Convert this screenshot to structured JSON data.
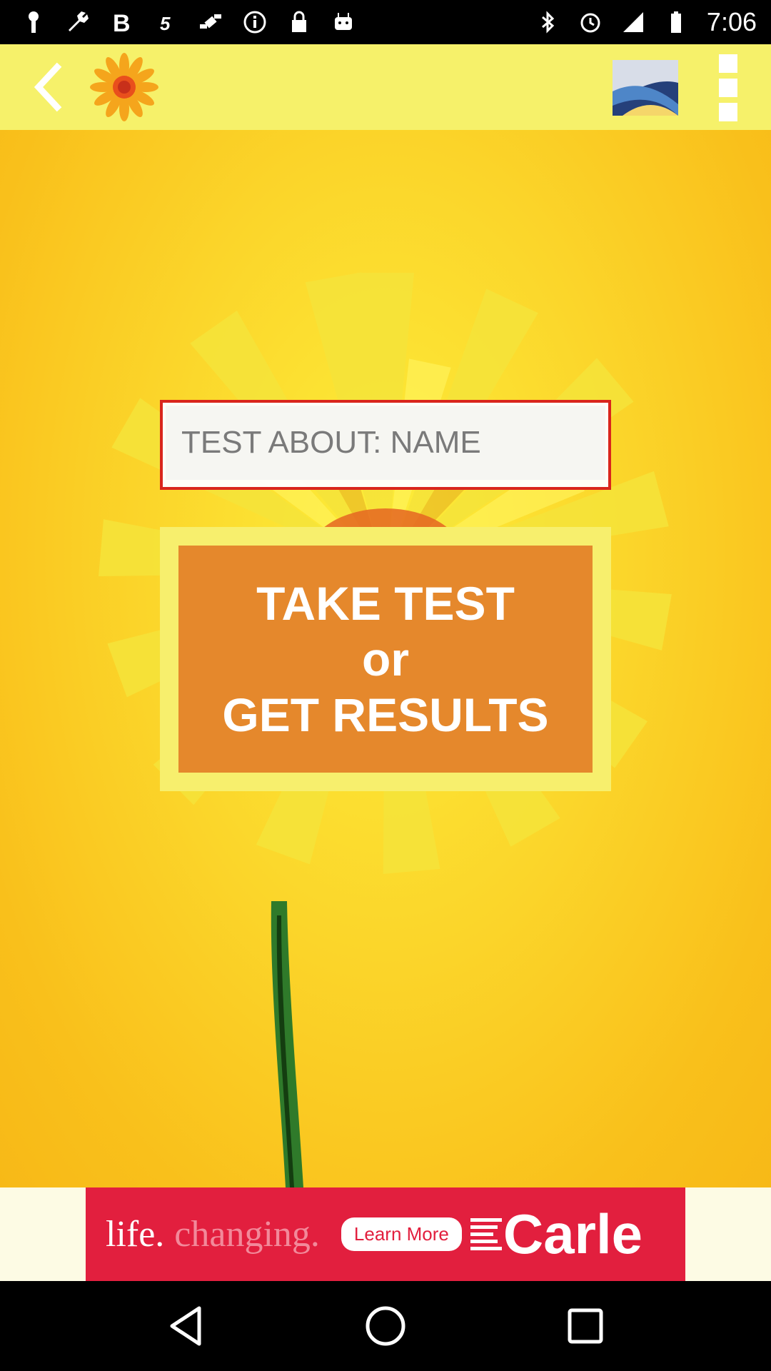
{
  "status_bar": {
    "time": "7:06",
    "left_icons": [
      "key-icon",
      "wrench-icon",
      "bold-b-icon",
      "5-icon",
      "fake-gps-icon",
      "info-icon",
      "lock-icon",
      "android-icon"
    ],
    "right_icons": [
      "bluetooth-icon",
      "alarm-icon",
      "signal-icon",
      "battery-icon"
    ]
  },
  "app_bar": {
    "back_icon": "chevron-left-icon",
    "logo_icon": "flower-logo-icon",
    "mail_icon": "mail-icon",
    "menu_icon": "overflow-menu-icon"
  },
  "main": {
    "name_input_placeholder": "TEST ABOUT: NAME",
    "button_line1": "TAKE TEST",
    "button_line2": "or",
    "button_line3": "GET RESULTS"
  },
  "ad": {
    "word1": "life.",
    "word2": "changing.",
    "cta": "Learn More",
    "brand": "Carle"
  },
  "nav": {
    "back": "nav-back-icon",
    "home": "nav-home-icon",
    "recents": "nav-recents-icon"
  },
  "colors": {
    "app_bar": "#f6f16a",
    "background": "#fbd52a",
    "button": "#e5882c",
    "field_border": "#d9261c",
    "ad": "#e21f3e"
  }
}
